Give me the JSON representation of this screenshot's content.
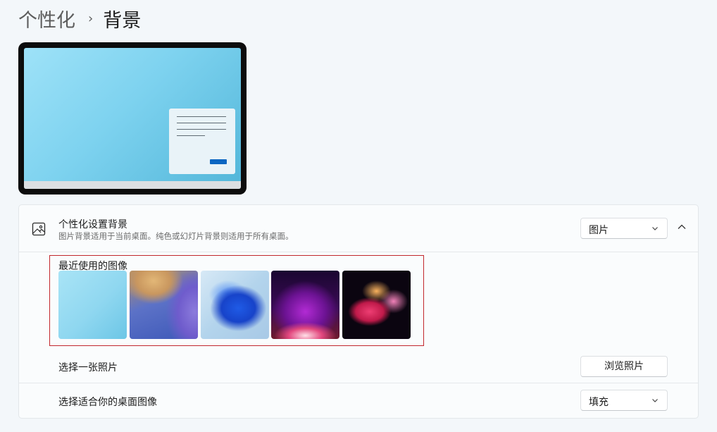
{
  "breadcrumb": {
    "parent": "个性化",
    "separator": "›",
    "current": "背景"
  },
  "background": {
    "title": "个性化设置背景",
    "subtitle": "图片背景适用于当前桌面。纯色或幻灯片背景则适用于所有桌面。",
    "icon": "picture-icon",
    "dropdown_value": "图片",
    "recent_images_label": "最近使用的图像",
    "recent_images": [
      {
        "name": "light-blue-gradient"
      },
      {
        "name": "gold-blue-abstract"
      },
      {
        "name": "blue-bloom"
      },
      {
        "name": "purple-glow"
      },
      {
        "name": "colorful-ribbons"
      }
    ]
  },
  "choose_photo": {
    "label": "选择一张照片",
    "button_label": "浏览照片"
  },
  "fit": {
    "label": "选择适合你的桌面图像",
    "dropdown_value": "填充"
  },
  "colors": {
    "accent": "#0b66c2",
    "highlight_frame": "#c2272d"
  }
}
